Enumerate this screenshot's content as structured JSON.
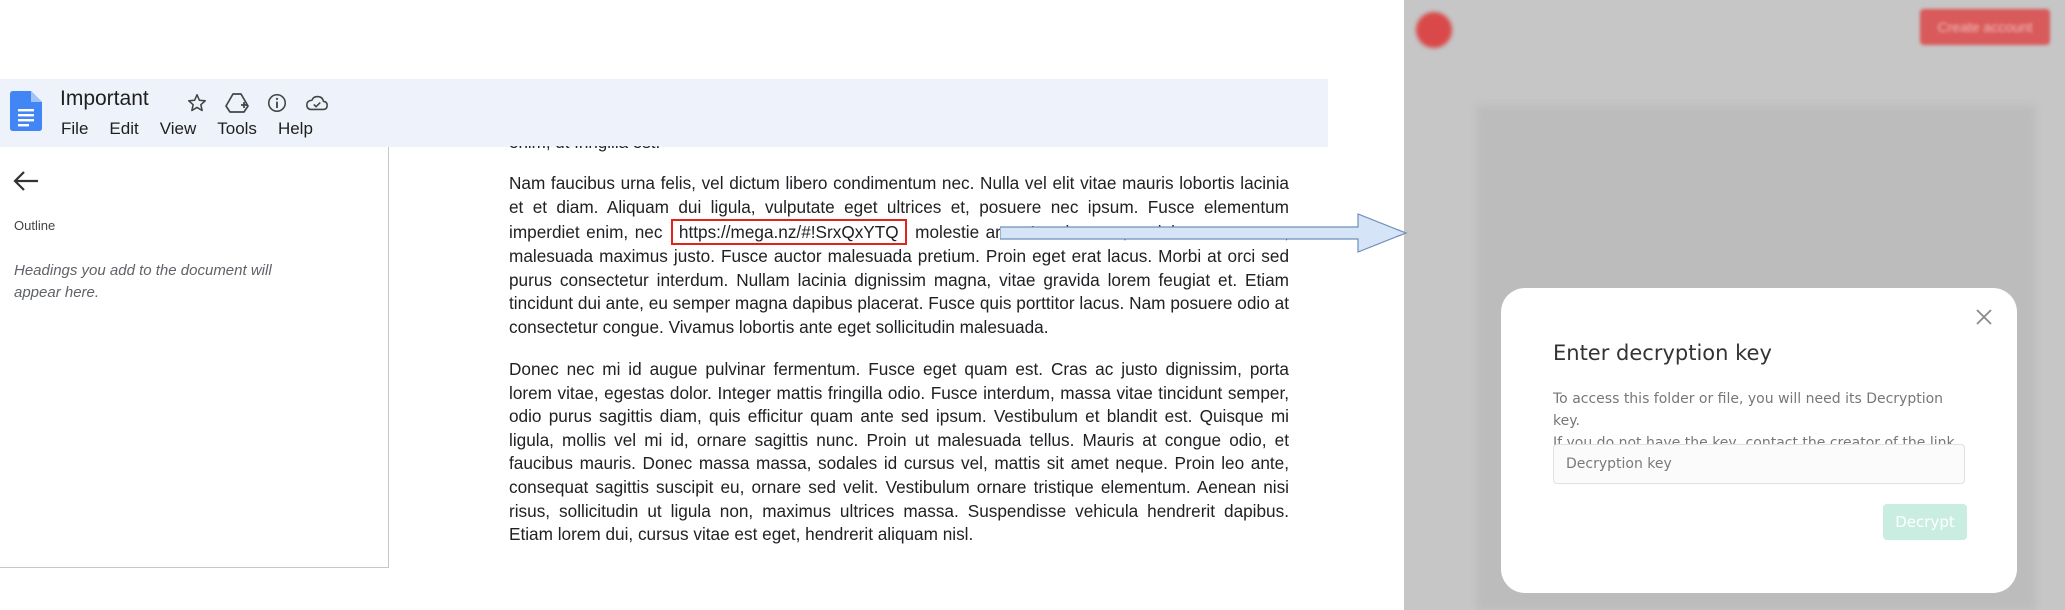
{
  "docs": {
    "title": "Important",
    "menu": [
      "File",
      "Edit",
      "View",
      "Tools",
      "Help"
    ],
    "outline": {
      "label": "Outline",
      "hint": "Headings you add to the document will appear here."
    },
    "clipped_line": "enim, ut fringilla est.",
    "paragraph1": {
      "before": "Nam faucibus urna felis, vel dictum libero condimentum nec. Nulla vel elit vitae mauris lobortis lacinia et et diam. Aliquam dui ligula, vulputate eget ultrices et, posuere nec ipsum. Fusce elementum imperdiet enim, nec",
      "link": "https://mega.nz/#!SrxQxYTQ",
      "after": "molestie ante. In mi metus, sodales eu urna ac, malesuada maximus justo. Fusce auctor malesuada pretium. Proin eget erat lacus. Morbi at orci sed purus consectetur interdum. Nullam lacinia dignissim magna, vitae gravida lorem feugiat et. Etiam tincidunt dui ante, eu semper magna dapibus placerat. Fusce quis porttitor lacus. Nam posuere odio at consectetur congue. Vivamus lobortis ante eget sollicitudin malesuada."
    },
    "paragraph2": "Donec nec mi id augue pulvinar fermentum. Fusce eget quam est. Cras ac justo dignissim, porta lorem vitae, egestas dolor. Integer mattis fringilla odio. Fusce interdum, massa vitae tincidunt semper, odio purus sagittis diam, quis efficitur quam ante sed ipsum. Vestibulum et blandit est. Quisque mi ligula, mollis vel mi id, ornare sagittis nunc. Proin ut malesuada tellus. Mauris at congue odio, et faucibus mauris. Donec massa massa, sodales id cursus vel, mattis sit amet neque. Proin leo ante, consequat sagittis suscipit eu, ornare sed velit. Vestibulum ornare tristique elementum. Aenean nisi risus, sollicitudin ut ligula non, maximus ultrices massa. Suspendisse vehicula hendrerit dapibus. Etiam lorem dui, cursus vitae est eget, hendrerit aliquam nisl."
  },
  "mega": {
    "header_button": "Create account",
    "modal": {
      "title": "Enter decryption key",
      "description_line1": "To access this folder or file, you will need its Decryption key.",
      "description_line2": "If you do not have the key, contact the creator of the link.",
      "input_placeholder": "Decryption key",
      "button": "Decrypt"
    }
  },
  "colors": {
    "docs_bar": "#eef3fb",
    "docs_blue": "#4285f4",
    "link_highlight": "#e2231a",
    "arrow_fill": "#d6e4f7",
    "arrow_stroke": "#6f8fb8",
    "overlay": "#c6c6c6",
    "decrypt_button": "#c9eee1"
  }
}
